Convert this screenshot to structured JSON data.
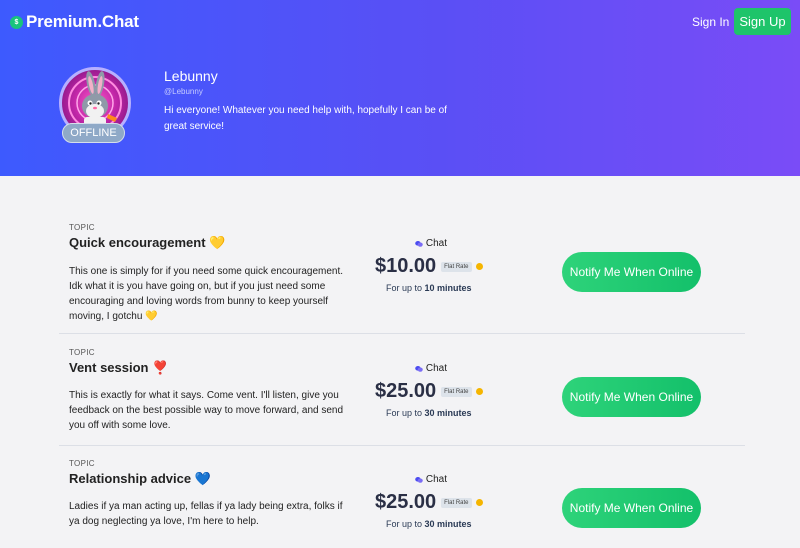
{
  "header": {
    "logo": "Premium.Chat",
    "logo_badge": "$",
    "sign_in": "Sign In",
    "sign_up": "Sign Up"
  },
  "profile": {
    "status": "OFFLINE",
    "name": "Lebunny",
    "handle": "@Lebunny",
    "bio": "Hi everyone! Whatever you need help with, hopefully I can be of great service!"
  },
  "topics": [
    {
      "label": "TOPIC",
      "title": "Quick encouragement 💛",
      "description": "This one is simply for if you need some quick encouragement. Idk what it is you have going on, but if you just need some encouraging and loving words from bunny to keep yourself moving, I gotchu 💛",
      "chat": "Chat",
      "price": "$10.00",
      "rate": "Flat Rate",
      "upto_prefix": "For up to ",
      "upto_value": "10 minutes",
      "button": "Notify Me When Online"
    },
    {
      "label": "TOPIC",
      "title": "Vent session ❣️",
      "description": "This is exactly for what it says. Come vent. I'll listen, give you feedback on the best possible way to move forward, and send you off with some love.",
      "chat": "Chat",
      "price": "$25.00",
      "rate": "Flat Rate",
      "upto_prefix": "For up to ",
      "upto_value": "30 minutes",
      "button": "Notify Me When Online"
    },
    {
      "label": "TOPIC",
      "title": "Relationship advice 💙",
      "description": "Ladies if ya man acting up, fellas if ya lady being extra, folks if ya dog neglecting ya love, I'm here to help.",
      "chat": "Chat",
      "price": "$25.00",
      "rate": "Flat Rate",
      "upto_prefix": "For up to ",
      "upto_value": "30 minutes",
      "button": "Notify Me When Online"
    }
  ],
  "colors": {
    "header_start": "#3d5afe",
    "header_end": "#7a4cf7",
    "green": "#1ec46a",
    "background": "#f3f3f5"
  },
  "icons": {
    "chat": "chat-bubbles-icon",
    "status_dot": "status-dot-icon"
  }
}
